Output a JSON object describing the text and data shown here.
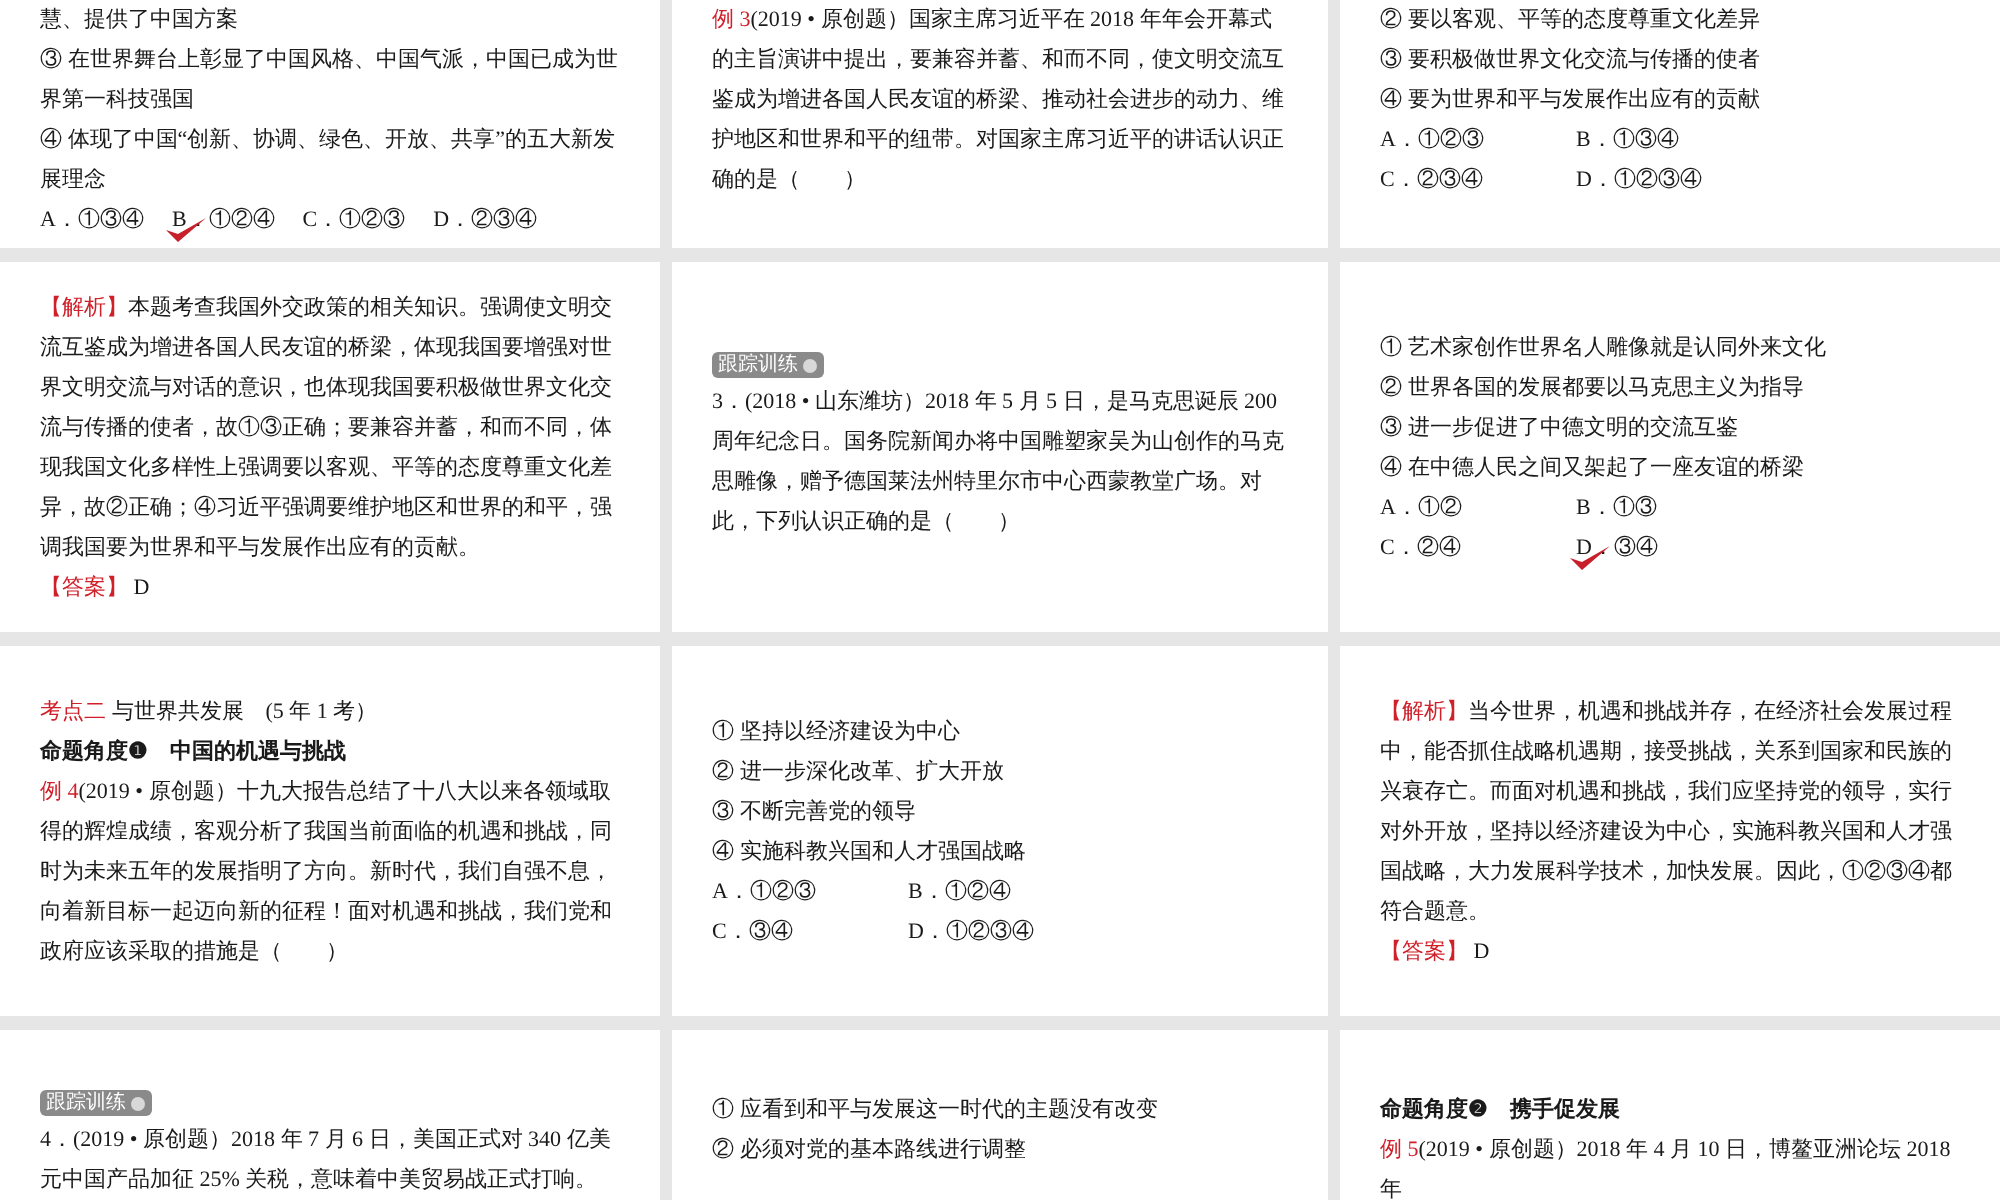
{
  "slides": [
    {
      "items": [
        {
          "kind": "para",
          "text": "慧、提供了中国方案"
        },
        {
          "kind": "para",
          "text": "③ 在世界舞台上彰显了中国风格、中国气派，中国已成为世界第一科技强国"
        },
        {
          "kind": "para",
          "text": "④ 体现了中国“创新、协调、绿色、开放、共享”的五大新发展理念"
        },
        {
          "kind": "options-row",
          "choices": [
            {
              "label": "A．①③④",
              "checked": false
            },
            {
              "label": "B．①②④",
              "checked": true
            },
            {
              "label": "C．①②③",
              "checked": false
            },
            {
              "label": "D．②③④",
              "checked": false
            }
          ]
        }
      ]
    },
    {
      "items": [
        {
          "kind": "para",
          "prefix": "例 3",
          "text": "(2019 • 原创题）国家主席习近平在 2018 年年会开幕式的主旨演讲中提出，要兼容并蓄、和而不同，使文明交流互鉴成为增进各国人民友谊的桥梁、推动社会进步的动力、维护地区和世界和平的纽带。对国家主席习近平的讲话认识正确的是（　　）"
        }
      ]
    },
    {
      "items": [
        {
          "kind": "para",
          "text": "② 要以客观、平等的态度尊重文化差异"
        },
        {
          "kind": "para",
          "text": "③ 要积极做世界文化交流与传播的使者"
        },
        {
          "kind": "para",
          "text": "④ 要为世界和平与发展作出应有的贡献"
        },
        {
          "kind": "options-grid",
          "choices": [
            {
              "label": "A．①②③",
              "checked": false
            },
            {
              "label": "B．①③④",
              "checked": false
            },
            {
              "label": "C．②③④",
              "checked": false
            },
            {
              "label": "D．①②③④",
              "checked": false
            }
          ]
        }
      ]
    },
    {
      "items": [
        {
          "kind": "para",
          "prefix": "【解析】",
          "text": "本题考查我国外交政策的相关知识。强调使文明交流互鉴成为增进各国人民友谊的桥梁，体现我国要增强对世界文明交流与对话的意识，也体现我国要积极做世界文化交流与传播的使者，故①③正确；要兼容并蓄，和而不同，体现我国文化多样性上强调要以客观、平等的态度尊重文化差异，故②正确；④习近平强调要维护地区和世界的和平，强调我国要为世界和平与发展作出应有的贡献。"
        },
        {
          "kind": "para",
          "prefix": "【答案】",
          "text": " D"
        }
      ]
    },
    {
      "items": [
        {
          "kind": "tag",
          "text": "跟踪训练"
        },
        {
          "kind": "para",
          "text": "3．(2018 • 山东潍坊）2018 年 5 月 5 日，是马克思诞辰 200 周年纪念日。国务院新闻办将中国雕塑家吴为山创作的马克思雕像，赠予德国莱法州特里尔市中心西蒙教堂广场。对此，下列认识正确的是（　　）"
        }
      ]
    },
    {
      "items": [
        {
          "kind": "para",
          "text": "① 艺术家创作世界名人雕像就是认同外来文化"
        },
        {
          "kind": "para",
          "text": "② 世界各国的发展都要以马克思主义为指导"
        },
        {
          "kind": "para",
          "text": "③ 进一步促进了中德文明的交流互鉴"
        },
        {
          "kind": "para",
          "text": "④ 在中德人民之间又架起了一座友谊的桥梁"
        },
        {
          "kind": "options-grid",
          "choices": [
            {
              "label": "A．①②",
              "checked": false
            },
            {
              "label": "B．①③",
              "checked": false
            },
            {
              "label": "C．②④",
              "checked": false
            },
            {
              "label": "D．③④",
              "checked": true
            }
          ]
        }
      ]
    },
    {
      "items": [
        {
          "kind": "para",
          "prefix": "考点二",
          "text": " 与世界共发展　(5 年 1 考）"
        },
        {
          "kind": "heading",
          "text": "命题角度❶　中国的机遇与挑战"
        },
        {
          "kind": "para",
          "prefix": "例 4",
          "text": "(2019 • 原创题）十九大报告总结了十八大以来各领域取得的辉煌成绩，客观分析了我国当前面临的机遇和挑战，同时为未来五年的发展指明了方向。新时代，我们自强不息，向着新目标一起迈向新的征程！面对机遇和挑战，我们党和政府应该采取的措施是（　　）"
        }
      ]
    },
    {
      "items": [
        {
          "kind": "para",
          "text": "① 坚持以经济建设为中心"
        },
        {
          "kind": "para",
          "text": "② 进一步深化改革、扩大开放"
        },
        {
          "kind": "para",
          "text": "③ 不断完善党的领导"
        },
        {
          "kind": "para",
          "text": "④ 实施科教兴国和人才强国战略"
        },
        {
          "kind": "options-grid",
          "choices": [
            {
              "label": "A．①②③",
              "checked": false
            },
            {
              "label": "B．①②④",
              "checked": false
            },
            {
              "label": "C．③④",
              "checked": false
            },
            {
              "label": "D．①②③④",
              "checked": false
            }
          ]
        }
      ]
    },
    {
      "items": [
        {
          "kind": "para",
          "prefix": "【解析】",
          "text": "当今世界，机遇和挑战并存，在经济社会发展过程中，能否抓住战略机遇期，接受挑战，关系到国家和民族的兴衰存亡。而面对机遇和挑战，我们应坚持党的领导，实行对外开放，坚持以经济建设为中心，实施科教兴国和人才强国战略，大力发展科学技术，加快发展。因此，①②③④都符合题意。"
        },
        {
          "kind": "para",
          "prefix": "【答案】",
          "text": " D"
        }
      ]
    },
    {
      "items": [
        {
          "kind": "tag",
          "text": "跟踪训练"
        },
        {
          "kind": "para",
          "text": "4．(2019 • 原创题）2018 年 7 月 6 日，美国正式对 340 亿美元中国产品加征 25% 关税，意味着中美贸易战正式打响。"
        }
      ]
    },
    {
      "items": [
        {
          "kind": "para",
          "text": "① 应看到和平与发展这一时代的主题没有改变"
        },
        {
          "kind": "para",
          "text": "② 必须对党的基本路线进行调整"
        }
      ]
    },
    {
      "items": [
        {
          "kind": "heading",
          "text": "命题角度❷　携手促发展"
        },
        {
          "kind": "para",
          "prefix": "例 5",
          "text": "(2019 • 原创题）2018 年 4 月 10 日，博鳌亚洲论坛 2018 年"
        }
      ]
    }
  ]
}
